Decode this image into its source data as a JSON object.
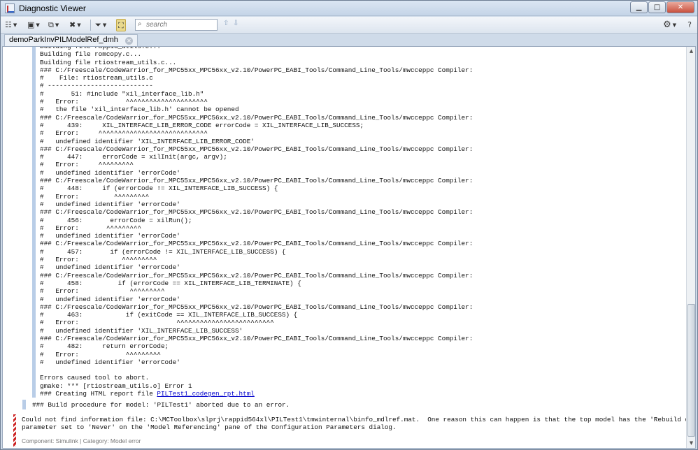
{
  "window": {
    "title": "Diagnostic Viewer"
  },
  "window_controls": {
    "minimize": "▁",
    "maximize": "□",
    "close": "✕"
  },
  "search": {
    "placeholder": "search"
  },
  "tab": {
    "label": "demoParkInvPILModelRef_dmh"
  },
  "log_lines": [
    "Building file rappid_utils.c...",
    "Building file romcopy.c...",
    "Building file rtiostream_utils.c...",
    "### C:/Freescale/CodeWarrior_for_MPC55xx_MPC56xx_v2.10/PowerPC_EABI_Tools/Command_Line_Tools/mwcceppc Compiler:",
    "#    File: rtiostream_utils.c",
    "# ---------------------------",
    "#       51: #include \"xil_interface_lib.h\"",
    "#   Error:            ^^^^^^^^^^^^^^^^^^^^^",
    "#   the file 'xil_interface_lib.h' cannot be opened",
    "### C:/Freescale/CodeWarrior_for_MPC55xx_MPC56xx_v2.10/PowerPC_EABI_Tools/Command_Line_Tools/mwcceppc Compiler:",
    "#      439:     XIL_INTERFACE_LIB_ERROR_CODE errorCode = XIL_INTERFACE_LIB_SUCCESS;",
    "#   Error:     ^^^^^^^^^^^^^^^^^^^^^^^^^^^^",
    "#   undefined identifier 'XIL_INTERFACE_LIB_ERROR_CODE'",
    "### C:/Freescale/CodeWarrior_for_MPC55xx_MPC56xx_v2.10/PowerPC_EABI_Tools/Command_Line_Tools/mwcceppc Compiler:",
    "#      447:     errorCode = xilInit(argc, argv);",
    "#   Error:     ^^^^^^^^^",
    "#   undefined identifier 'errorCode'",
    "### C:/Freescale/CodeWarrior_for_MPC55xx_MPC56xx_v2.10/PowerPC_EABI_Tools/Command_Line_Tools/mwcceppc Compiler:",
    "#      448:     if (errorCode != XIL_INTERFACE_LIB_SUCCESS) {",
    "#   Error:         ^^^^^^^^^",
    "#   undefined identifier 'errorCode'",
    "### C:/Freescale/CodeWarrior_for_MPC55xx_MPC56xx_v2.10/PowerPC_EABI_Tools/Command_Line_Tools/mwcceppc Compiler:",
    "#      456:       errorCode = xilRun();",
    "#   Error:       ^^^^^^^^^",
    "#   undefined identifier 'errorCode'",
    "### C:/Freescale/CodeWarrior_for_MPC55xx_MPC56xx_v2.10/PowerPC_EABI_Tools/Command_Line_Tools/mwcceppc Compiler:",
    "#      457:       if (errorCode != XIL_INTERFACE_LIB_SUCCESS) {",
    "#   Error:           ^^^^^^^^^",
    "#   undefined identifier 'errorCode'",
    "### C:/Freescale/CodeWarrior_for_MPC55xx_MPC56xx_v2.10/PowerPC_EABI_Tools/Command_Line_Tools/mwcceppc Compiler:",
    "#      458:         if (errorCode == XIL_INTERFACE_LIB_TERMINATE) {",
    "#   Error:             ^^^^^^^^^",
    "#   undefined identifier 'errorCode'",
    "### C:/Freescale/CodeWarrior_for_MPC55xx_MPC56xx_v2.10/PowerPC_EABI_Tools/Command_Line_Tools/mwcceppc Compiler:",
    "#      463:           if (exitCode == XIL_INTERFACE_LIB_SUCCESS) {",
    "#   Error:                         ^^^^^^^^^^^^^^^^^^^^^^^^^",
    "#   undefined identifier 'XIL_INTERFACE_LIB_SUCCESS'",
    "### C:/Freescale/CodeWarrior_for_MPC55xx_MPC56xx_v2.10/PowerPC_EABI_Tools/Command_Line_Tools/mwcceppc Compiler:",
    "#      482:     return errorCode;",
    "#   Error:            ^^^^^^^^^",
    "#   undefined identifier 'errorCode'",
    "",
    "Errors caused tool to abort.",
    "gmake: *** [rtiostream_utils.o] Error 1"
  ],
  "report_line": {
    "prefix": "### Creating HTML report file ",
    "link": "PILTest1_codegen_rpt.html"
  },
  "build_message": "### Build procedure for model: 'PILTest1' aborted due to an error.",
  "error_message": {
    "line1": "Could not find information file: C:\\MCToolbox\\slprj\\rappid564xl\\PILTest1\\tmwinternal\\binfo_mdlref.mat.  One reason this can happen is that the top model has the 'Rebuild options'",
    "line2": "parameter set to 'Never' on the 'Model Referencing' pane of the Configuration Parameters dialog.",
    "meta": "Component: Simulink | Category: Model error"
  }
}
